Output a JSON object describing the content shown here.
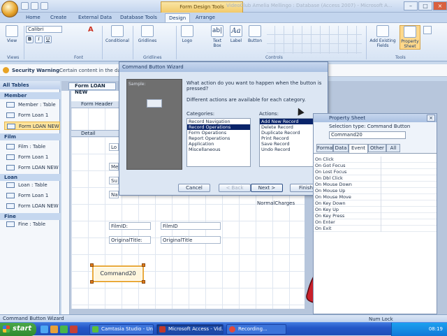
{
  "window": {
    "title": "VideoClub Amelia Mellingo : Database (Access 2007) - Microsoft A...",
    "contextual_tab": "Form Design Tools"
  },
  "ribbon": {
    "tabs": [
      "Home",
      "Create",
      "External Data",
      "Database Tools",
      "Design",
      "Arrange"
    ],
    "active_tab": "Design",
    "font_name": "Calibri",
    "buttons": {
      "view": "View",
      "conditional": "Conditional",
      "gridlines": "Gridlines",
      "logo": "Logo",
      "text_box": "Text Box",
      "label": "Label",
      "button": "Button",
      "add_existing_fields": "Add Existing Fields",
      "property_sheet": "Property Sheet"
    },
    "groups": [
      "Views",
      "Font",
      "Gridlines",
      "Controls",
      "Tools"
    ]
  },
  "security": {
    "label": "Security Warning",
    "text": "Certain content in the database"
  },
  "nav": {
    "header": "All Tables",
    "groups": [
      {
        "name": "Member",
        "items": [
          "Member : Table",
          "Form Loan 1",
          "Form LOAN NEW"
        ]
      },
      {
        "name": "Film",
        "items": [
          "Film : Table",
          "Form Loan 1",
          "Form LOAN NEW"
        ]
      },
      {
        "name": "Loan",
        "items": [
          "Loan : Table",
          "Form Loan 1",
          "Form LOAN NEW"
        ]
      },
      {
        "name": "Fine",
        "items": [
          "Fine : Table"
        ]
      }
    ],
    "selected": "Form LOAN NEW"
  },
  "designer": {
    "doc_tab": "Form LOAN NEW",
    "form_header": "Form Header",
    "detail": "Detail",
    "controls": {
      "normal_charges": "NormalCharges",
      "filmid_label": "FilmID:",
      "filmid_field": "FilmID",
      "original_title_label": "OriginalTitle:",
      "original_title_field": "OriginalTitle",
      "command": "Command20"
    }
  },
  "dialog": {
    "title": "Command Button Wizard",
    "sample": "Sample:",
    "question": "What action do you want to happen when the button is pressed?",
    "note": "Different actions are available for each category.",
    "categories_label": "Categories:",
    "actions_label": "Actions:",
    "categories": [
      "Record Navigation",
      "Record Operations",
      "Form Operations",
      "Report Operations",
      "Application",
      "Miscellaneous"
    ],
    "selected_category": "Record Operations",
    "actions": [
      "Add New Record",
      "Delete Record",
      "Duplicate Record",
      "Print Record",
      "Save Record",
      "Undo Record"
    ],
    "selected_action": "Add New Record",
    "buttons": {
      "cancel": "Cancel",
      "back": "< Back",
      "next": "Next >",
      "finish": "Finish"
    }
  },
  "property_sheet": {
    "title": "Property Sheet",
    "selection_type": "Selection type:  Command Button",
    "selected_control": "Command20",
    "tabs": [
      "Format",
      "Data",
      "Event",
      "Other",
      "All"
    ],
    "active_tab": "Event",
    "rows": [
      "On Click",
      "On Got Focus",
      "On Lost Focus",
      "On Dbl Click",
      "On Mouse Down",
      "On Mouse Up",
      "On Mouse Move",
      "On Key Down",
      "On Key Up",
      "On Key Press",
      "On Enter",
      "On Exit"
    ]
  },
  "status": {
    "left": "Command Button Wizard",
    "right": "Num Lock"
  },
  "taskbar": {
    "start": "start",
    "items": [
      "Camtasia Studio - Unt...",
      "Microsoft Access - Vid...",
      "Recording..."
    ],
    "active_item": "Microsoft Access - Vid...",
    "clock": "08:19"
  }
}
